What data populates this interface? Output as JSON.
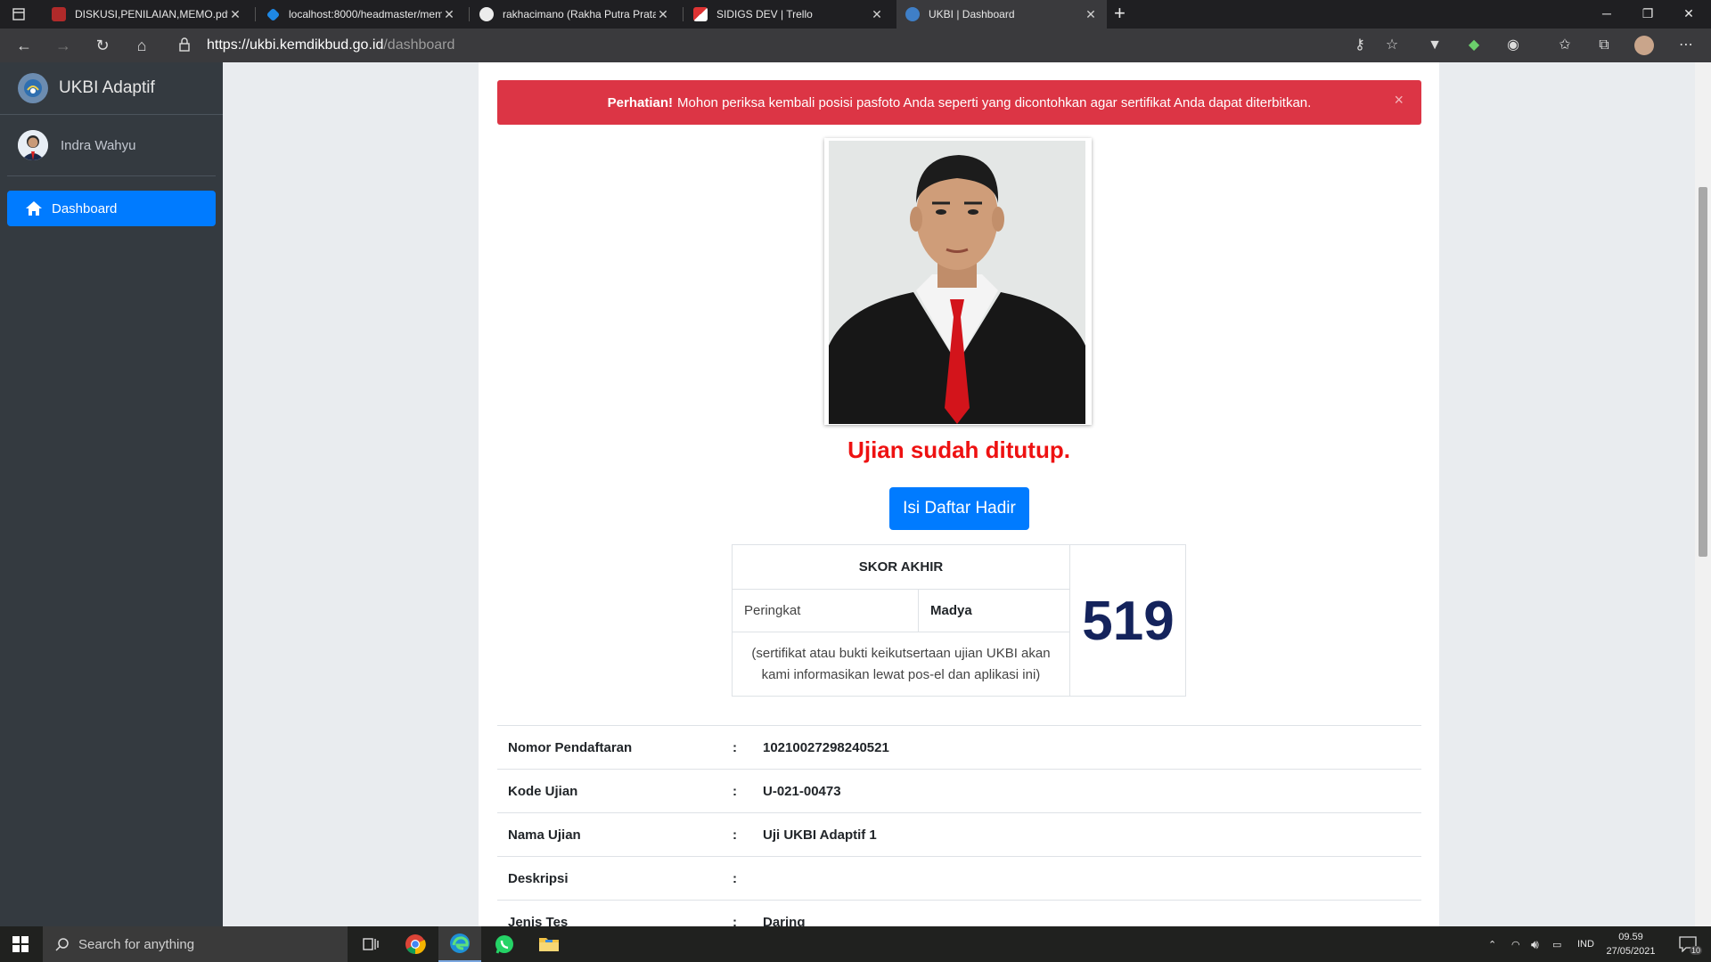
{
  "browser": {
    "tabs": [
      {
        "label": "DISKUSI,PENILAIAN,MEMO.pdf",
        "active": false
      },
      {
        "label": "localhost:8000/headmaster/mem",
        "active": false
      },
      {
        "label": "rakhacimano (Rakha Putra Pratar",
        "active": false
      },
      {
        "label": "SIDIGS DEV | Trello",
        "active": false
      },
      {
        "label": "UKBI | Dashboard",
        "active": true
      }
    ],
    "url_host": "https://ukbi.kemdikbud.go.id",
    "url_path": "/dashboard"
  },
  "sidebar": {
    "brand": "UKBI Adaptif",
    "user_name": "Indra Wahyu",
    "items": [
      {
        "label": "Dashboard",
        "active": true
      }
    ]
  },
  "alert": {
    "title": "Perhatian!",
    "message": "Mohon periksa kembali posisi pasfoto Anda seperti yang dicontohkan agar sertifikat Anda dapat diterbitkan.",
    "close": "×"
  },
  "main": {
    "status_text": "Ujian sudah ditutup.",
    "attendance_button": "Isi Daftar Hadir",
    "score": {
      "header": "SKOR AKHIR",
      "rank_label": "Peringkat",
      "rank_value": "Madya",
      "note": "(sertifikat atau bukti keikutsertaan ujian UKBI akan kami informasikan lewat pos-el dan aplikasi ini)",
      "value": "519"
    },
    "details": [
      {
        "key": "Nomor Pendaftaran",
        "sep": ":",
        "value": "10210027298240521"
      },
      {
        "key": "Kode Ujian",
        "sep": ":",
        "value": "U-021-00473"
      },
      {
        "key": "Nama Ujian",
        "sep": ":",
        "value": "Uji UKBI Adaptif 1"
      },
      {
        "key": "Deskripsi",
        "sep": ":",
        "value": ""
      },
      {
        "key": "Jenis Tes",
        "sep": ":",
        "value": "Daring"
      }
    ]
  },
  "taskbar": {
    "search_placeholder": "Search for anything",
    "language": "IND",
    "time": "09.59",
    "date": "27/05/2021",
    "notification_count": "10"
  },
  "colors": {
    "sidebar_bg": "#343a40",
    "primary": "#007bff",
    "danger": "#dc3545",
    "status_red": "#ee1111",
    "score_navy": "#14235c"
  }
}
